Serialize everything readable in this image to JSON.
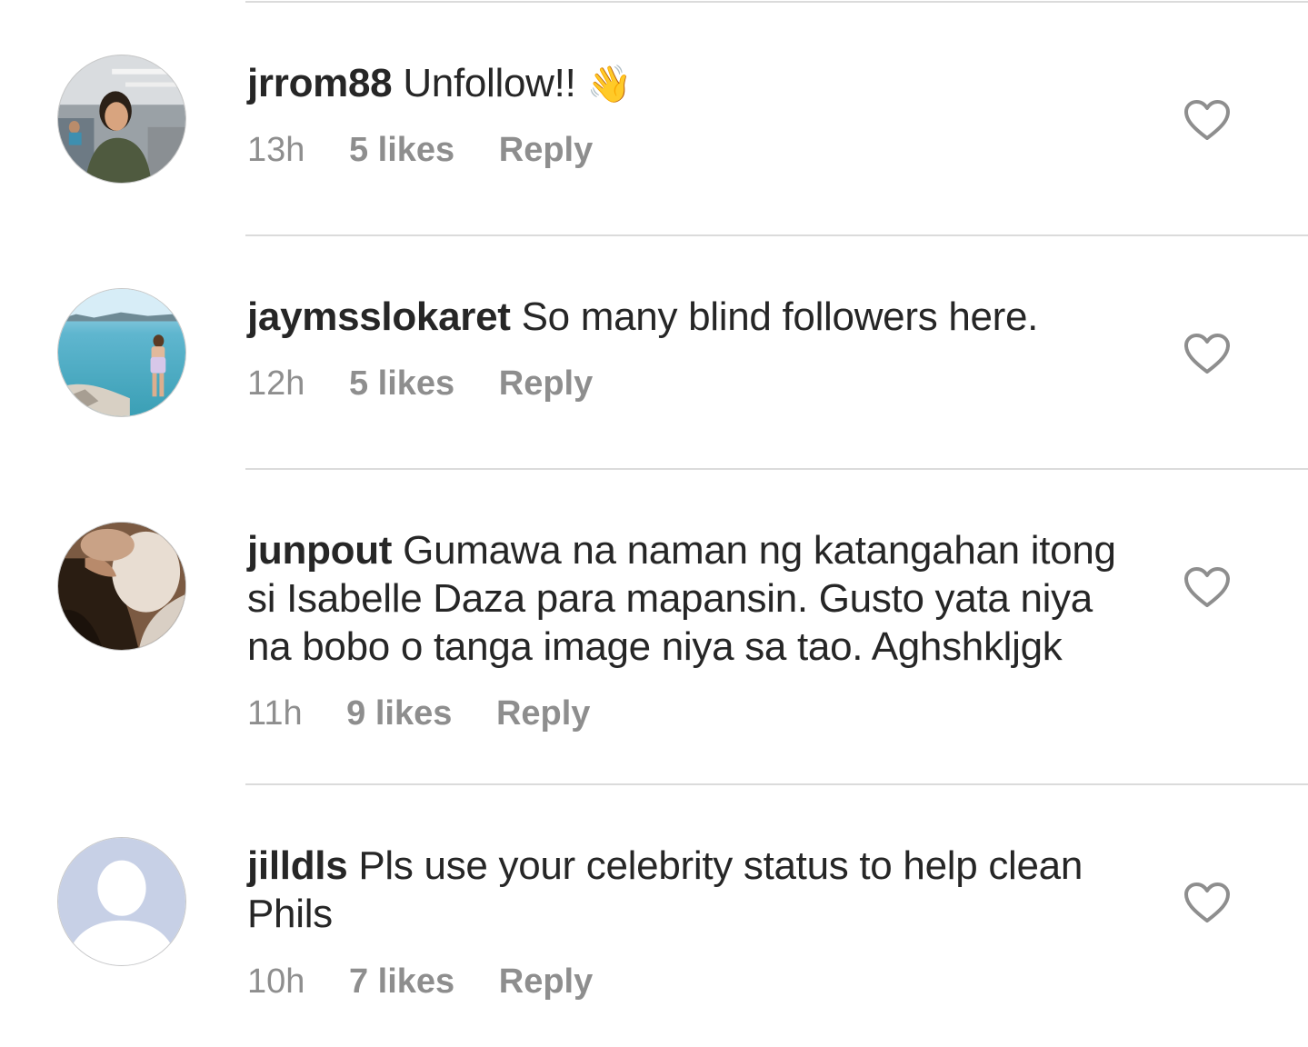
{
  "comments": [
    {
      "username": "jrrom88",
      "text": "Unfollow!!",
      "emoji": "👋",
      "time": "13h",
      "likes": "5 likes",
      "reply": "Reply"
    },
    {
      "username": "jaymsslokaret",
      "text": "So many blind followers here.",
      "time": "12h",
      "likes": "5 likes",
      "reply": "Reply"
    },
    {
      "username": "junpout",
      "text": "Gumawa na naman ng katangahan itong si Isabelle Daza para mapansin. Gusto yata niya na bobo o tanga image niya sa tao. Aghshkljgk",
      "time": "11h",
      "likes": "9 likes",
      "reply": "Reply"
    },
    {
      "username": "jilldls",
      "text": "Pls use your celebrity status to help clean Phils",
      "time": "10h",
      "likes": "7 likes",
      "reply": "Reply"
    }
  ],
  "icons": {
    "like": "heart-outline-icon",
    "avatar_default": "default-user-silhouette"
  }
}
